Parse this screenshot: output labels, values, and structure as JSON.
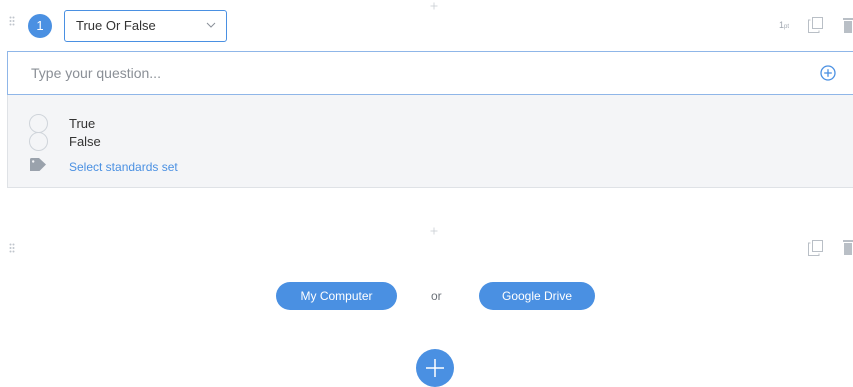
{
  "question": {
    "number": "1",
    "type_selected": "True Or False",
    "points_value": "1",
    "points_unit": "pt",
    "input_placeholder": "Type your question...",
    "answers": [
      {
        "label": "True"
      },
      {
        "label": "False"
      }
    ],
    "standards_link": "Select standards set"
  },
  "upload": {
    "my_computer_label": "My Computer",
    "or_label": "or",
    "google_drive_label": "Google Drive"
  },
  "icons": {
    "drag": "drag-handle-icon",
    "chevron": "chevron-down-icon",
    "copy": "copy-icon",
    "delete": "trash-icon",
    "add_circle": "add-circle-icon",
    "tag": "tag-icon",
    "plus": "plus-icon"
  },
  "colors": {
    "accent": "#4a90e2",
    "panel_bg": "#f4f5f7",
    "muted_icon": "#bfc5cc"
  }
}
